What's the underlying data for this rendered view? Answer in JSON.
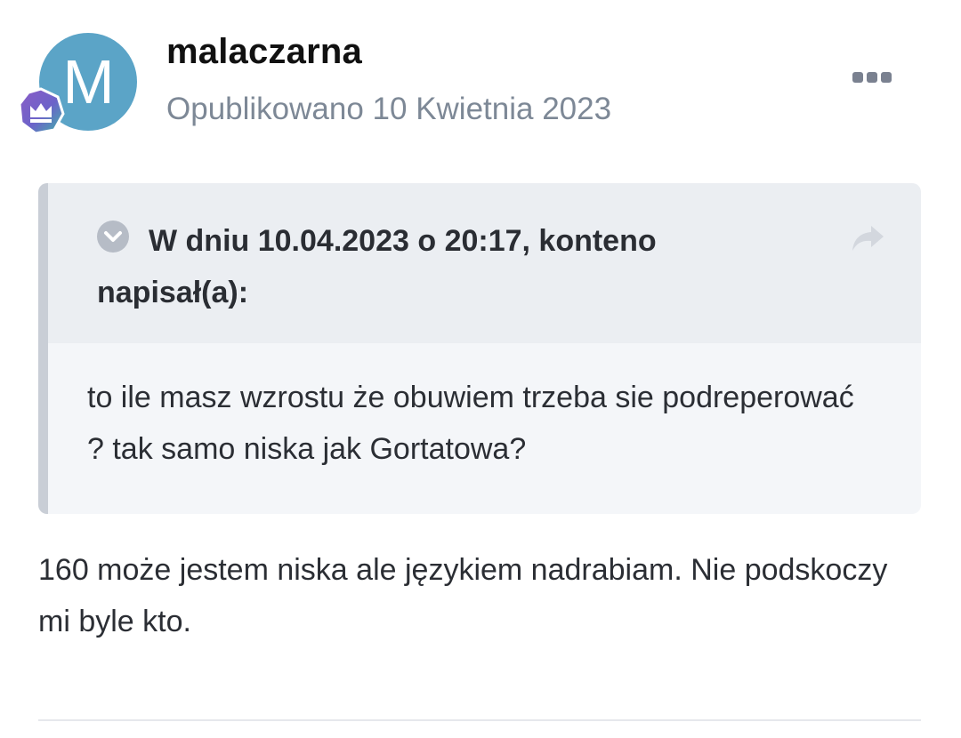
{
  "author": {
    "name": "malaczarna",
    "avatar_letter": "M",
    "avatar_color": "#5ba4c7",
    "rank_badge_icon": "crown-badge-icon"
  },
  "post": {
    "date": "Opublikowano 10 Kwietnia 2023",
    "more_icon": "more-dots-icon",
    "content": "160 może jestem niska ale językiem nadrabiam. Nie podskoczy mi byle kto."
  },
  "quote": {
    "toggle_icon": "chevron-down-icon",
    "share_icon": "share-arrow-icon",
    "citation": "W dniu 10.04.2023 o 20:17, konteno napisał(a):",
    "text": "to ile masz wzrostu że obuwiem trzeba sie podreperować ? tak samo niska jak Gortatowa?"
  },
  "colors": {
    "accent": "#5ba4c7",
    "quote_border": "#c9ced6",
    "quote_header_bg": "#ebeef2",
    "quote_body_bg": "#f4f6f9",
    "muted_text": "#7d8896"
  }
}
